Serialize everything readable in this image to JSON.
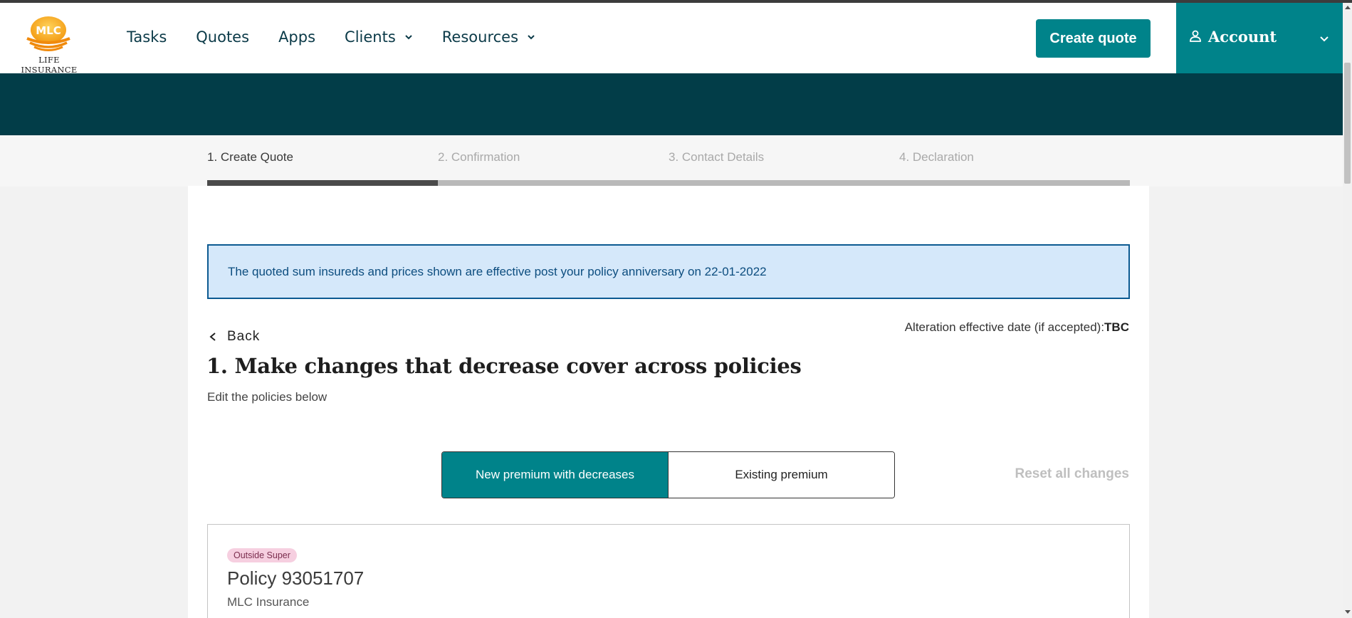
{
  "header": {
    "logo_mark": "MLC",
    "logo_text": "LIFE INSURANCE",
    "nav": [
      {
        "label": "Tasks",
        "has_dropdown": false
      },
      {
        "label": "Quotes",
        "has_dropdown": false
      },
      {
        "label": "Apps",
        "has_dropdown": false
      },
      {
        "label": "Clients",
        "has_dropdown": true
      },
      {
        "label": "Resources",
        "has_dropdown": true
      }
    ],
    "create_quote_label": "Create quote",
    "account_label": "Account"
  },
  "steps": [
    {
      "label": "1. Create Quote",
      "active": true
    },
    {
      "label": "2. Confirmation",
      "active": false
    },
    {
      "label": "3. Contact Details",
      "active": false
    },
    {
      "label": "4. Declaration",
      "active": false
    }
  ],
  "progress": {
    "current_step": 1,
    "total_steps": 4
  },
  "notice_text": "The quoted sum insureds and prices shown are effective post your policy anniversary on 22-01-2022",
  "back_label": "Back",
  "alteration": {
    "label": "Alteration effective date (if accepted):",
    "value": "TBC"
  },
  "page_title": "1. Make changes that decrease cover across policies",
  "page_subtitle": "Edit the policies below",
  "premium_toggle": {
    "selected": "New premium with decreases",
    "options": [
      "New premium with decreases",
      "Existing premium"
    ]
  },
  "reset_label": "Reset all changes",
  "policy": {
    "tag": "Outside Super",
    "name": "Policy 93051707",
    "company": "MLC Insurance"
  },
  "colors": {
    "accent": "#00838a",
    "header_band": "#023d48",
    "notice_bg": "#d5e8fa",
    "notice_border": "#0c5a91",
    "tag_bg": "#f6cfe0"
  }
}
